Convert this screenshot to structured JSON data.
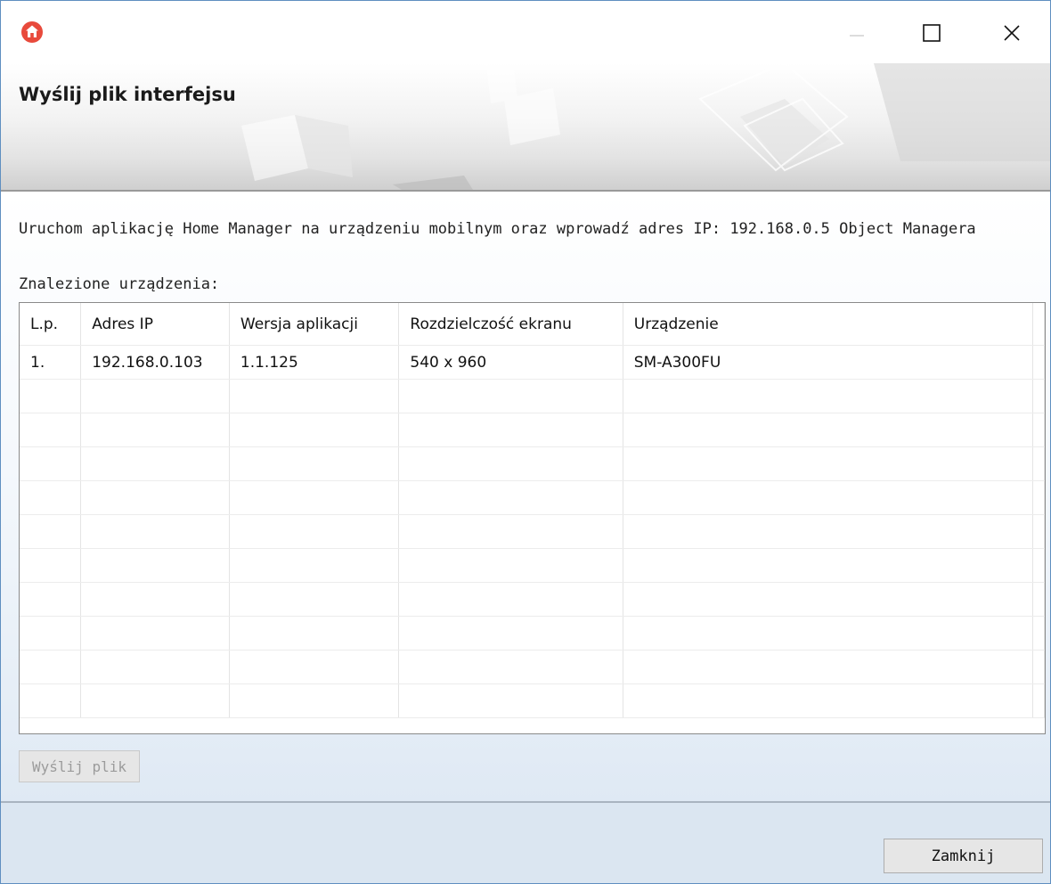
{
  "window": {
    "app_icon": "home-icon",
    "controls": [
      "minimize-icon",
      "maximize-icon",
      "close-icon"
    ]
  },
  "header": {
    "title": "Wyślij plik interfejsu"
  },
  "main": {
    "instruction": "Uruchom aplikację Home Manager na urządzeniu mobilnym oraz wprowadź adres IP: 192.168.0.5 Object Managera",
    "found_label": "Znalezione urządzenia:",
    "table": {
      "columns": [
        "L.p.",
        "Adres IP",
        "Wersja aplikacji",
        "Rozdzielczość ekranu",
        "Urządzenie"
      ],
      "rows": [
        [
          "1.",
          "192.168.0.103",
          "1.1.125",
          "540 x 960",
          "SM-A300FU"
        ]
      ]
    },
    "send_button": "Wyślij plik"
  },
  "footer": {
    "close_button": "Zamknij"
  },
  "colors": {
    "accent": "#e84a3c",
    "window_border": "#5f8fc0",
    "footer_bg": "#dbe6f1"
  }
}
